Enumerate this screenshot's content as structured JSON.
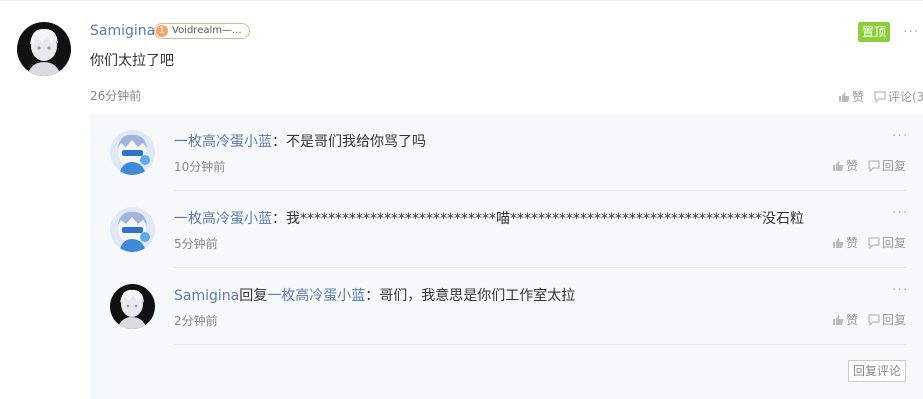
{
  "main_comment": {
    "user": "Samigina",
    "badge_level": "1",
    "badge_text": "Voidrealm—...",
    "pin_label": "置顶",
    "more": "···",
    "text": "你们太拉了吧",
    "time": "26分钟前",
    "like_label": "赞",
    "comment_label": "评论(3"
  },
  "replies": [
    {
      "user": "一枚高冷蛋小蓝",
      "sep": "：",
      "text": "不是哥们我给你骂了吗",
      "time": "10分钟前",
      "like_label": "赞",
      "reply_label": "回复",
      "more": "···"
    },
    {
      "user": "一枚高冷蛋小蓝",
      "sep": "：",
      "text": "我****************************喵************************************没石粒",
      "time": "5分钟前",
      "like_label": "赞",
      "reply_label": "回复",
      "more": "···"
    },
    {
      "user": "Samigina",
      "reply_word": "回复",
      "target": "一枚高冷蛋小蓝",
      "sep": "：",
      "text": "哥们，我意思是你们工作室太拉",
      "time": "2分钟前",
      "like_label": "赞",
      "reply_label": "回复",
      "more": "···"
    }
  ],
  "reply_comment_button": "回复评论",
  "colors": {
    "accent_link": "#5b7aa8",
    "pin_green": "#8fcf3c",
    "badge_orange": "#f0a56a",
    "reply_bg": "#f7f8fa"
  },
  "icons": {
    "like": "thumbs-up-icon",
    "comment": "comment-icon",
    "more": "more-dots-icon"
  }
}
